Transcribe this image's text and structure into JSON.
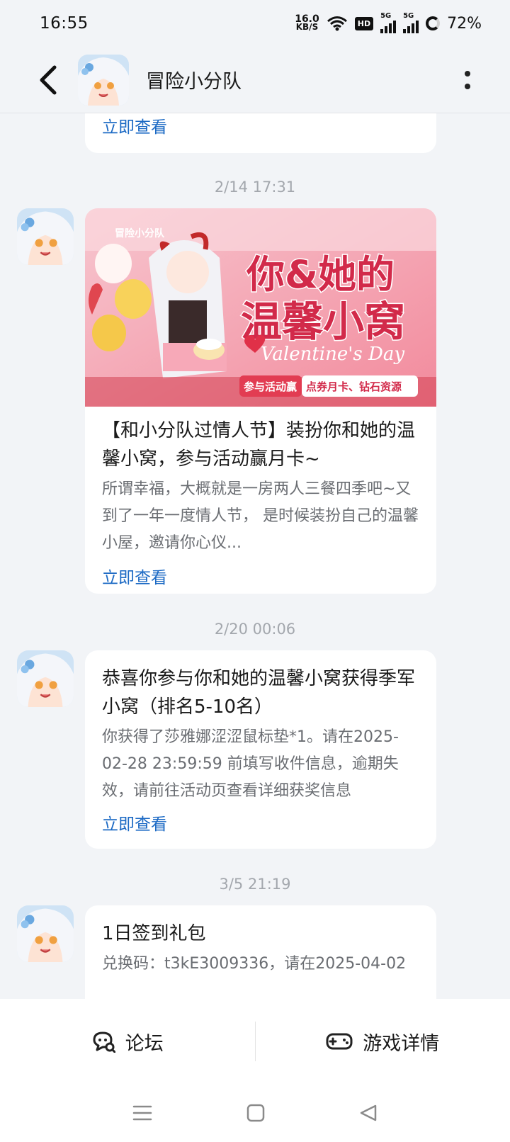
{
  "status": {
    "time": "16:55",
    "net_speed_value": "16.0",
    "net_speed_unit": "KB/S",
    "hd_label": "HD",
    "signal1_label": "5G",
    "signal2_label": "5G",
    "battery": "72%"
  },
  "header": {
    "title": "冒险小分队"
  },
  "messages": [
    {
      "link": "立即查看"
    },
    {
      "timestamp": "2/14  17:31",
      "banner": {
        "logo_text": "冒险小分队",
        "headline_line1": "你&她的",
        "headline_line2": "温馨小窝",
        "script_text": "Valentine's Day",
        "badge_left": "参与活动赢",
        "badge_right": "点券月卡、钻石资源"
      },
      "title": "【和小分队过情人节】装扮你和她的温馨小窝，参与活动赢月卡~",
      "body": "所谓幸福，大概就是一房两人三餐四季吧~又到了一年一度情人节， 是时候装扮自己的温馨小屋，邀请你心仪...",
      "link": "立即查看"
    },
    {
      "timestamp": "2/20  00:06",
      "title": "恭喜你参与你和她的温馨小窝获得季军小窝（排名5-10名）",
      "body": "你获得了莎雅娜涩涩鼠标垫*1。请在2025-02-28 23:59:59 前填写收件信息，逾期失效，请前往活动页查看详细获奖信息",
      "link": "立即查看"
    },
    {
      "timestamp": "3/5  21:19",
      "title": "1日签到礼包",
      "body": "兑换码：t3kE3009336，请在2025-04-02"
    }
  ],
  "bottom": {
    "forum_label": "论坛",
    "game_detail_label": "游戏详情"
  },
  "colors": {
    "link": "#1b69c4",
    "background": "#f2f4f7",
    "card": "#ffffff"
  }
}
